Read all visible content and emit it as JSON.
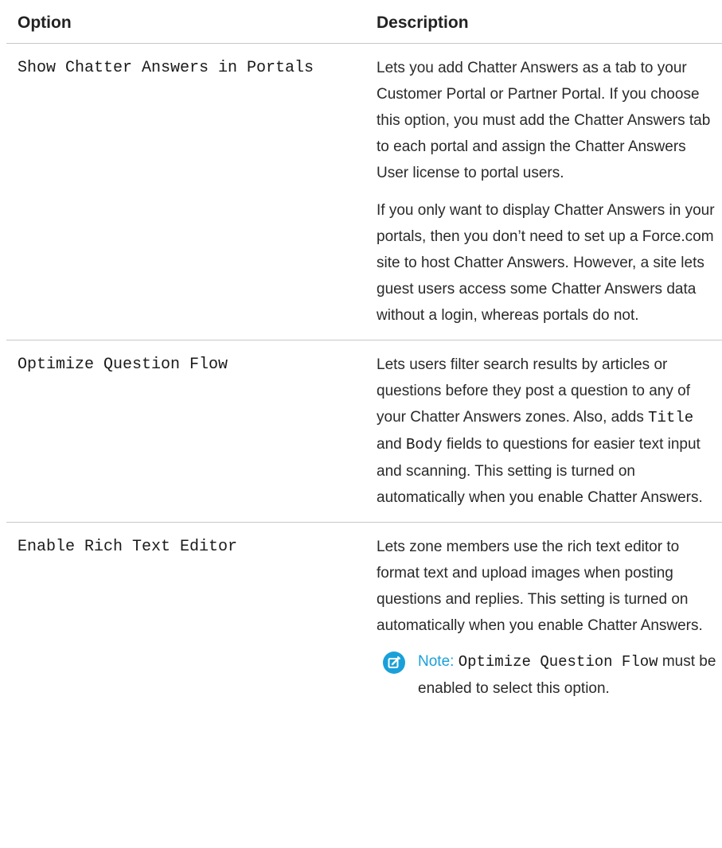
{
  "table": {
    "headers": {
      "option": "Option",
      "description": "Description"
    },
    "rows": [
      {
        "option": "Show Chatter Answers in Portals",
        "paragraphs": [
          "Lets you add Chatter Answers as a tab to your Customer Portal or Partner Portal. If you choose this option, you must add the Chatter Answers tab to each portal and assign the Chatter Answers User license to portal users.",
          "If you only want to display Chatter Answers in your portals, then you don’t need to set up a Force.com site to host Chatter Answers. However, a site lets guest users access some Chatter Answers data without a login, whereas portals do not."
        ]
      },
      {
        "option": "Optimize Question Flow",
        "desc_before": "Lets users filter search results by articles or questions before they post a question to any of your Chatter Answers zones. Also, adds ",
        "code1": "Title",
        "desc_mid": " and ",
        "code2": "Body",
        "desc_after": " fields to questions for easier text input and scanning. This setting is turned on automatically when you enable Chatter Answers."
      },
      {
        "option": "Enable Rich Text Editor",
        "description": "Lets zone members use the rich text editor to format text and upload images when posting questions and replies. This setting is turned on automatically when you enable Chatter Answers.",
        "note": {
          "label": "Note:",
          "code": "Optimize Question Flow",
          "text": " must be enabled to select this option."
        }
      }
    ]
  },
  "colors": {
    "note_accent": "#1aa0d9",
    "rule": "#c8c8c8"
  },
  "icons": {
    "note": "note-edit-icon"
  }
}
